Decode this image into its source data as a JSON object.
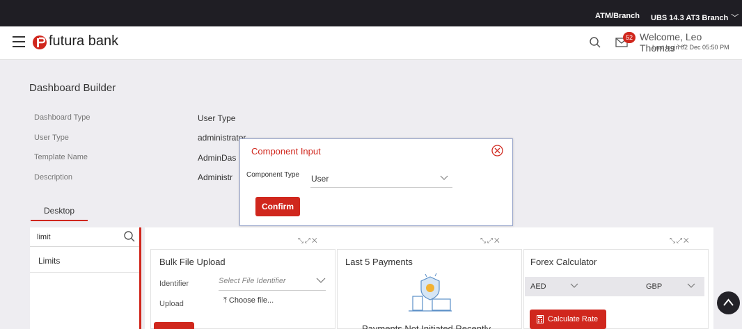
{
  "topbar": {
    "atm_link": "ATM/Branch",
    "branch": "UBS 14.3 AT3 Branch"
  },
  "header": {
    "bank_name": "futura bank",
    "mail_badge_count": "52",
    "welcome": "Welcome, Leo Thomas",
    "last_login": "Last login 02 Dec 05:50 PM"
  },
  "page": {
    "title": "Dashboard Builder",
    "fields": [
      {
        "label": "Dashboard Type",
        "value": "User Type"
      },
      {
        "label": "User Type",
        "value": "administrator"
      },
      {
        "label": "Template Name",
        "value": "AdminDas"
      },
      {
        "label": "Description",
        "value": "Administr"
      }
    ],
    "tab": "Desktop"
  },
  "left_panel": {
    "search_text": "limit",
    "items": [
      "Limits"
    ]
  },
  "cards": {
    "bulk_upload": {
      "title": "Bulk File Upload",
      "identifier_label": "Identifier",
      "identifier_placeholder": "Select File Identifier",
      "upload_label": "Upload",
      "choose_file": "Choose file..."
    },
    "payments": {
      "title": "Last 5 Payments",
      "empty_text": "Payments Not Initiated Recently"
    },
    "forex": {
      "title": "Forex Calculator",
      "from": "AED",
      "to": "GBP",
      "button": "Calculate Rate"
    }
  },
  "modal": {
    "title": "Component Input",
    "label": "Component Type",
    "selected": "User",
    "confirm": "Confirm"
  },
  "colors": {
    "accent": "#d0271d",
    "topbar": "#1f1e24",
    "background": "#eeedf1"
  },
  "icons": [
    "hamburger-icon",
    "futura-logo-icon",
    "search-icon",
    "mail-icon",
    "close-circle-icon",
    "chevron-down-icon",
    "calculator-icon",
    "chevron-up-icon",
    "upload-icon",
    "expand-icon"
  ]
}
